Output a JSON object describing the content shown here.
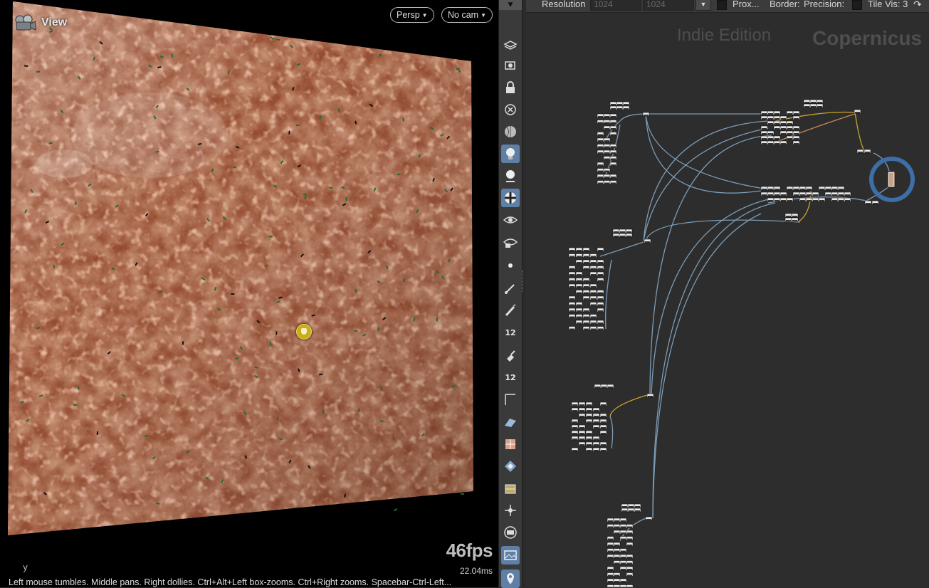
{
  "viewport": {
    "title": "View",
    "persp_label": "Persp",
    "camera_label": "No cam",
    "fps": "46fps",
    "frame_time": "22.04ms",
    "axis_label": "y",
    "status_text": "Left mouse tumbles. Middle pans. Right dollies. Ctrl+Alt+Left box-zooms. Ctrl+Right zooms. Spacebar-Ctrl-Left..."
  },
  "toolbar": {
    "tools": [
      {
        "icon": "display-options-icon"
      },
      {
        "icon": "camera-view-icon"
      },
      {
        "icon": "lock-icon"
      },
      {
        "icon": "close-tool-icon"
      },
      {
        "icon": "sphere-shading-icon"
      },
      {
        "icon": "light-bulb-icon",
        "active": true
      },
      {
        "icon": "light-add-icon"
      },
      {
        "icon": "checker-ball-icon",
        "active": true
      },
      {
        "icon": "eye-camera-icon"
      },
      {
        "icon": "eye-view-icon"
      },
      {
        "icon": "point-icon"
      },
      {
        "icon": "edge-pick-icon"
      },
      {
        "icon": "pencil-icon"
      },
      {
        "icon": "number-12-icon",
        "label": "12"
      },
      {
        "icon": "brush-icon"
      },
      {
        "icon": "number-12-brush-icon",
        "label": "12"
      },
      {
        "icon": "curve-icon"
      },
      {
        "icon": "plane-icon"
      },
      {
        "icon": "texture-checker-icon"
      },
      {
        "icon": "diamond-icon"
      },
      {
        "icon": "cube-uv-icon"
      },
      {
        "icon": "snap-icon"
      },
      {
        "icon": "frame-all-icon"
      },
      {
        "icon": "background-image-icon",
        "active": true
      },
      {
        "icon": "location-pin-icon",
        "active": true
      }
    ]
  },
  "network": {
    "resolution_label": "Resolution",
    "res_x": "1024",
    "res_y": "1024",
    "proxy_label": "Prox...",
    "border_label": "Border:",
    "precision_label": "Precision:",
    "tile_vis_label": "Tile Vis: 3",
    "watermark_edition": "Indie Edition",
    "watermark_context": "Copernicus"
  },
  "colors": {
    "terrain_base": "#8f4326",
    "terrain_light": "#c06c48",
    "wire_blue": "#7d9db8",
    "wire_yellow": "#c9a62b",
    "selection_ring": "#3d6ea8",
    "active_tool": "#5e7fa6"
  }
}
